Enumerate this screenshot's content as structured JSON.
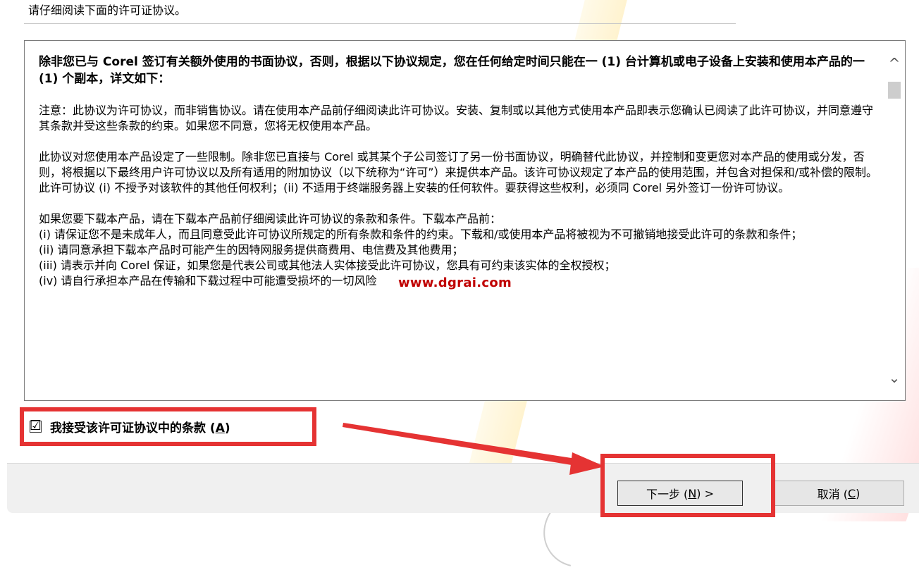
{
  "header": {
    "instruction": "请仔细阅读下面的许可证协议。"
  },
  "license": {
    "bold_intro": "除非您已与 Corel 签订有关额外使用的书面协议，否则，根据以下协议规定，您在任何给定时间只能在一 (1) 台计算机或电子设备上安装和使用本产品的一 (1) 个副本，详文如下：",
    "para1": "注意：此协议为许可协议，而非销售协议。请在使用本产品前仔细阅读此许可协议。安装、复制或以其他方式使用本产品即表示您确认已阅读了此许可协议，并同意遵守其条款并受这些条款的约束。如果您不同意，您将无权使用本产品。",
    "para2": "此协议对您使用本产品设定了一些限制。除非您已直接与 Corel 或其某个子公司签订了另一份书面协议，明确替代此协议，并控制和变更您对本产品的使用或分发，否则，将根据以下最终用户许可协议以及所有适用的附加协议（以下统称为“许可”）来提供本产品。该许可协议规定了本产品的使用范围，并包含对担保和/或补偿的限制。此许可协议 (i) 不授予对该软件的其他任何权利；(ii) 不适用于终端服务器上安装的任何软件。要获得这些权利，必须同 Corel 另外签订一份许可协议。",
    "para3_lead": "如果您要下载本产品，请在下载本产品前仔细阅读此许可协议的条款和条件。下载本产品前：",
    "item_i": "(i) 请保证您不是未成年人，而且同意受此许可协议所规定的所有条款和条件的约束。下载和/或使用本产品将被视为不可撤销地接受此许可的条款和条件；",
    "item_ii": "(ii) 请同意承担下载本产品时可能产生的因特网服务提供商费用、电信费及其他费用；",
    "item_iii": "(iii) 请表示并向 Corel 保证，如果您是代表公司或其他法人实体接受此许可协议，您具有可约束该实体的全权授权；",
    "item_iv": "(iv) 请自行承担本产品在传输和下载过程中可能遭受损坏的一切风险"
  },
  "watermark": {
    "url": "www.dgrai.com"
  },
  "accept": {
    "checked": true,
    "check_glyph": "☑",
    "label": "我接受该许可证协议中的条款 ",
    "mnemonic_open": "(",
    "mnemonic_key": "A",
    "mnemonic_close": ")"
  },
  "buttons": {
    "next_label": "下一步 (",
    "next_key": "N",
    "next_suffix": ") >",
    "cancel_label": "取消 (",
    "cancel_key": "C",
    "cancel_suffix": ")"
  },
  "scrollbar": {
    "up_glyph": "^",
    "down_glyph": "⌄"
  },
  "colors": {
    "highlight": "#e53333",
    "watermark": "#c00000"
  }
}
